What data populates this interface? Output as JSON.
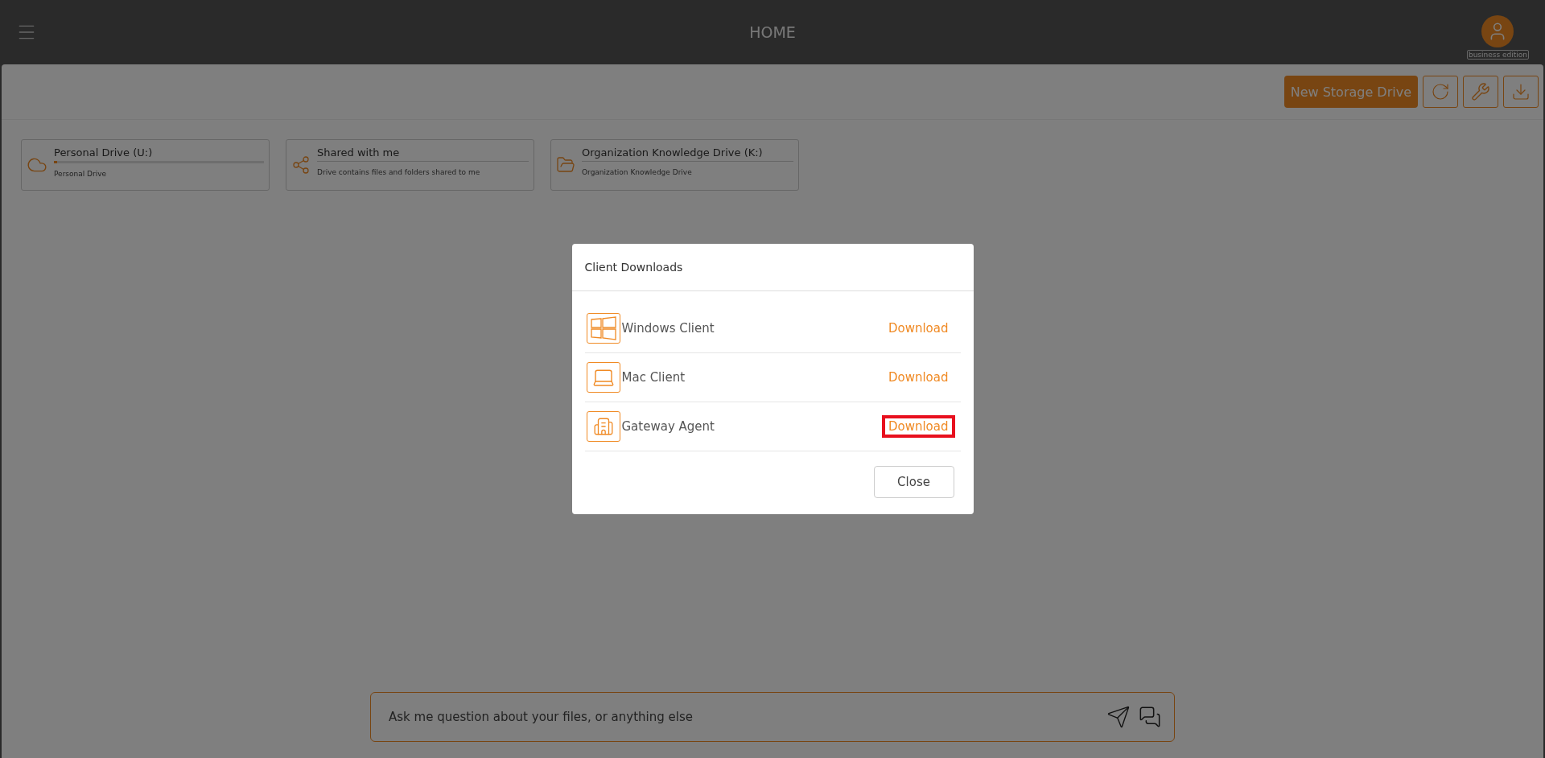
{
  "header": {
    "title": "HOME",
    "edition_badge": "business edition"
  },
  "toolbar": {
    "new_drive_button": "New Storage Drive"
  },
  "drives": [
    {
      "kind": "personal",
      "name": "Personal Drive (U:)",
      "description": "Personal Drive",
      "level": 0.015
    },
    {
      "kind": "shared",
      "name": "Shared with me",
      "description": "Drive contains files and folders shared to me"
    },
    {
      "kind": "organization",
      "name": "Organization Knowledge Drive (K:)",
      "description": "Organization Knowledge Drive"
    }
  ],
  "chat": {
    "placeholder": "Ask me question about your files, or anything else"
  },
  "dialog": {
    "title": "Client Downloads",
    "items": [
      {
        "kind": "windows",
        "name": "Windows Client",
        "action": "Download",
        "highlighted": false
      },
      {
        "kind": "mac",
        "name": "Mac Client",
        "action": "Download",
        "highlighted": false
      },
      {
        "kind": "gateway",
        "name": "Gateway Agent",
        "action": "Download",
        "highlighted": true
      }
    ],
    "close_button": "Close"
  }
}
